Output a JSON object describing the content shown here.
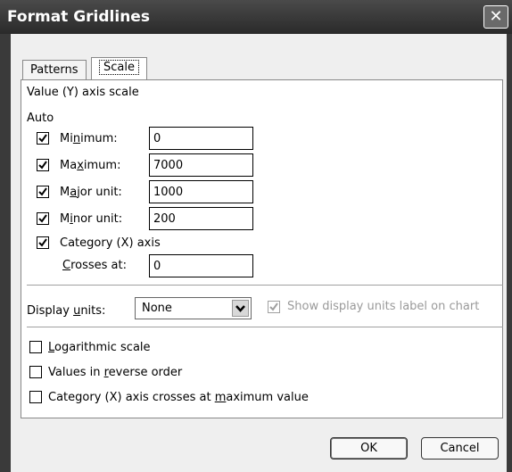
{
  "window": {
    "title": "Format Gridlines"
  },
  "tabs": [
    {
      "label": "Patterns",
      "active": false
    },
    {
      "label": "Scale",
      "active": true
    }
  ],
  "scale": {
    "section_title": "Value (Y) axis scale",
    "auto_label": "Auto",
    "minimum": {
      "pre": "Mi",
      "key": "n",
      "post": "imum:",
      "checked": true,
      "value": "0"
    },
    "maximum": {
      "pre": "Ma",
      "key": "x",
      "post": "imum:",
      "checked": true,
      "value": "7000"
    },
    "major": {
      "pre": "M",
      "key": "a",
      "post": "jor unit:",
      "checked": true,
      "value": "1000"
    },
    "minor": {
      "pre": "M",
      "key": "i",
      "post": "nor unit:",
      "checked": true,
      "value": "200"
    },
    "category_crosses": {
      "label": "Category (X) axis",
      "checked": true
    },
    "crosses_at": {
      "pre": "",
      "key": "C",
      "post": "rosses at:",
      "value": "0"
    }
  },
  "display_units": {
    "pre": "Display ",
    "key": "u",
    "post": "nits:",
    "value": "None",
    "show_label": {
      "label": "Show display units label on chart",
      "checked": true,
      "disabled": true
    }
  },
  "options": {
    "logarithmic": {
      "pre": "",
      "key": "L",
      "post": "ogarithmic scale",
      "checked": false
    },
    "reverse": {
      "pre": "Values in ",
      "key": "r",
      "post": "everse order",
      "checked": false
    },
    "max_value": {
      "pre": "Category (X) axis crosses at ",
      "key": "m",
      "post": "aximum value",
      "checked": false
    }
  },
  "buttons": {
    "ok": "OK",
    "cancel": "Cancel"
  },
  "icons": {
    "check": "check-icon",
    "close": "close-icon",
    "dropdown": "chevron-down-icon"
  }
}
